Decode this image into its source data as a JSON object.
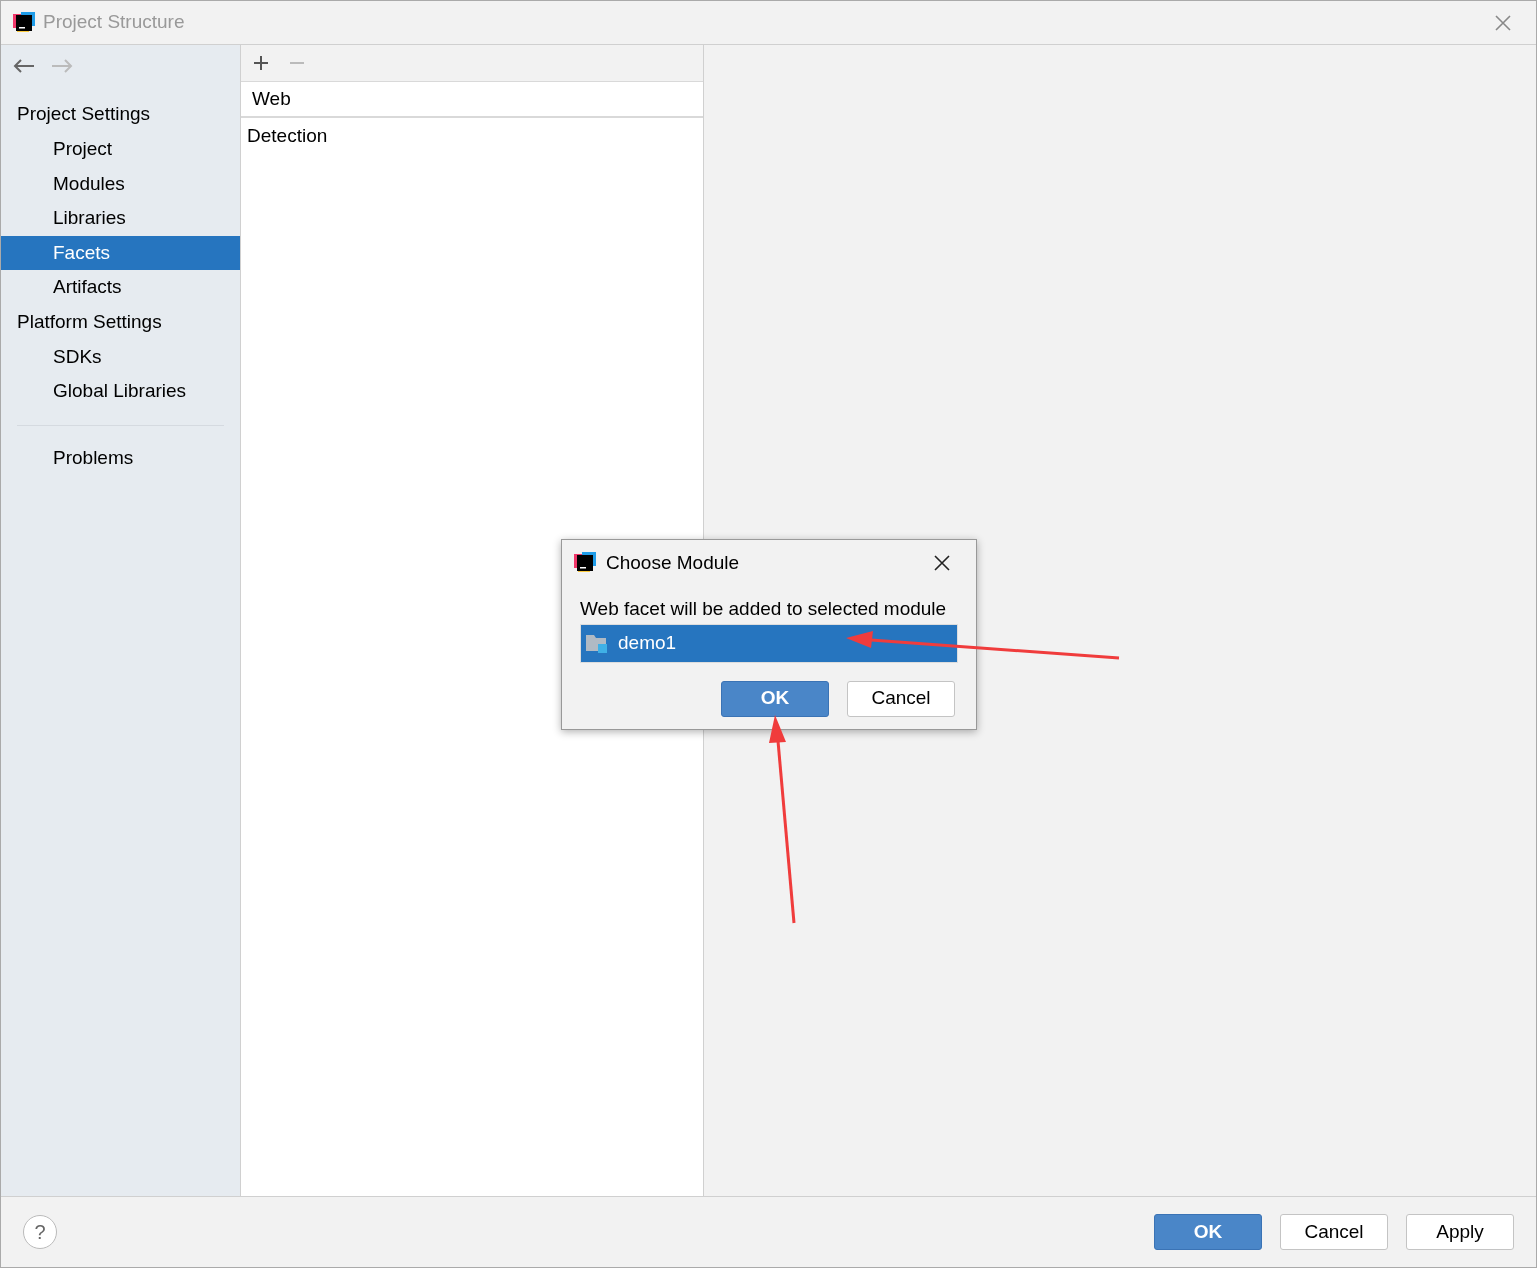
{
  "window": {
    "title": "Project Structure"
  },
  "sidebar": {
    "sections": [
      {
        "title": "Project Settings",
        "items": [
          {
            "label": "Project",
            "selected": false
          },
          {
            "label": "Modules",
            "selected": false
          },
          {
            "label": "Libraries",
            "selected": false
          },
          {
            "label": "Facets",
            "selected": true
          },
          {
            "label": "Artifacts",
            "selected": false
          }
        ]
      },
      {
        "title": "Platform Settings",
        "items": [
          {
            "label": "SDKs",
            "selected": false
          },
          {
            "label": "Global Libraries",
            "selected": false
          }
        ]
      }
    ],
    "footer_items": [
      {
        "label": "Problems",
        "selected": false
      }
    ]
  },
  "facets_panel": {
    "items": [
      {
        "label": "Web",
        "kind": "row"
      },
      {
        "label": "Detection",
        "kind": "row"
      }
    ]
  },
  "dialog": {
    "title": "Choose Module",
    "message": "Web facet will be added to selected module",
    "modules": [
      {
        "label": "demo1",
        "selected": true
      }
    ],
    "buttons": [
      {
        "label": "OK",
        "kind": "primary"
      },
      {
        "label": "Cancel",
        "kind": "default"
      }
    ]
  },
  "help_button": {
    "label": "?"
  },
  "buttons": [
    {
      "label": "OK",
      "kind": "primary"
    },
    {
      "label": "Cancel",
      "kind": "default"
    },
    {
      "label": "Apply",
      "kind": "default"
    }
  ]
}
